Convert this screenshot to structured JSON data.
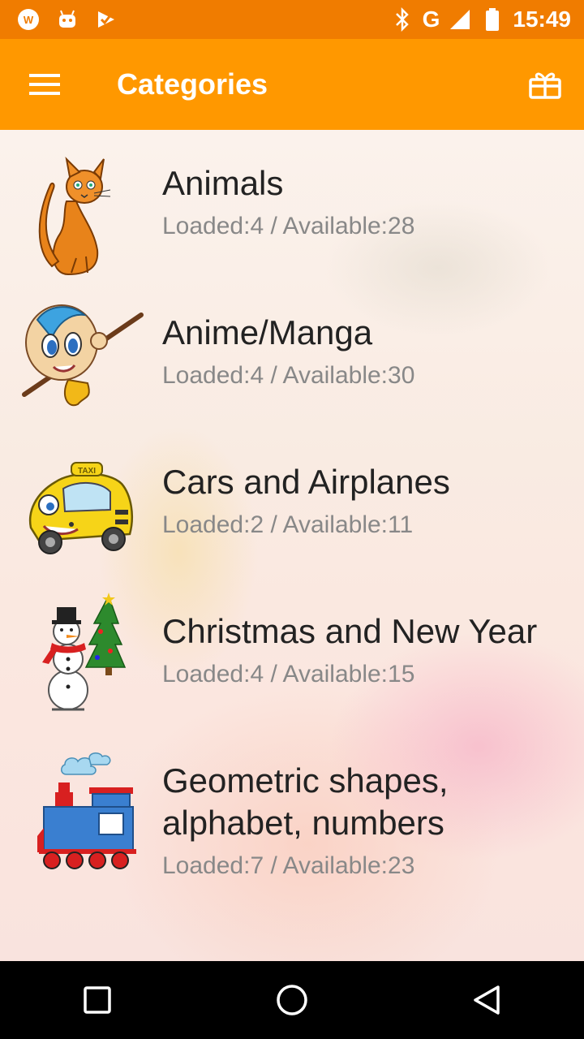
{
  "status_bar": {
    "time": "15:49",
    "network": "G",
    "icons": [
      "wp-app-icon",
      "android-icon",
      "play-check-icon",
      "bluetooth-icon",
      "signal-icon",
      "battery-icon"
    ]
  },
  "app_bar": {
    "title": "Categories",
    "menu_icon": "hamburger-menu-icon",
    "action_icon": "gift-icon"
  },
  "categories": [
    {
      "name": "Animals",
      "stats": "Loaded:4 / Available:28",
      "icon": "cat-icon"
    },
    {
      "name": "Anime/Manga",
      "stats": "Loaded:4 / Available:30",
      "icon": "anime-boy-icon"
    },
    {
      "name": "Cars and Airplanes",
      "stats": "Loaded:2 / Available:11",
      "icon": "taxi-car-icon"
    },
    {
      "name": "Christmas and New Year",
      "stats": "Loaded:4 / Available:15",
      "icon": "snowman-tree-icon"
    },
    {
      "name": "Geometric shapes, alphabet, numbers",
      "stats": "Loaded:7 / Available:23",
      "icon": "toy-train-icon"
    }
  ],
  "nav_bar": {
    "icons": [
      "recents-icon",
      "home-icon",
      "back-icon"
    ]
  },
  "colors": {
    "status_bar": "#f07c00",
    "app_bar": "#ff9800",
    "text_primary": "#222222",
    "text_secondary": "#888888"
  }
}
